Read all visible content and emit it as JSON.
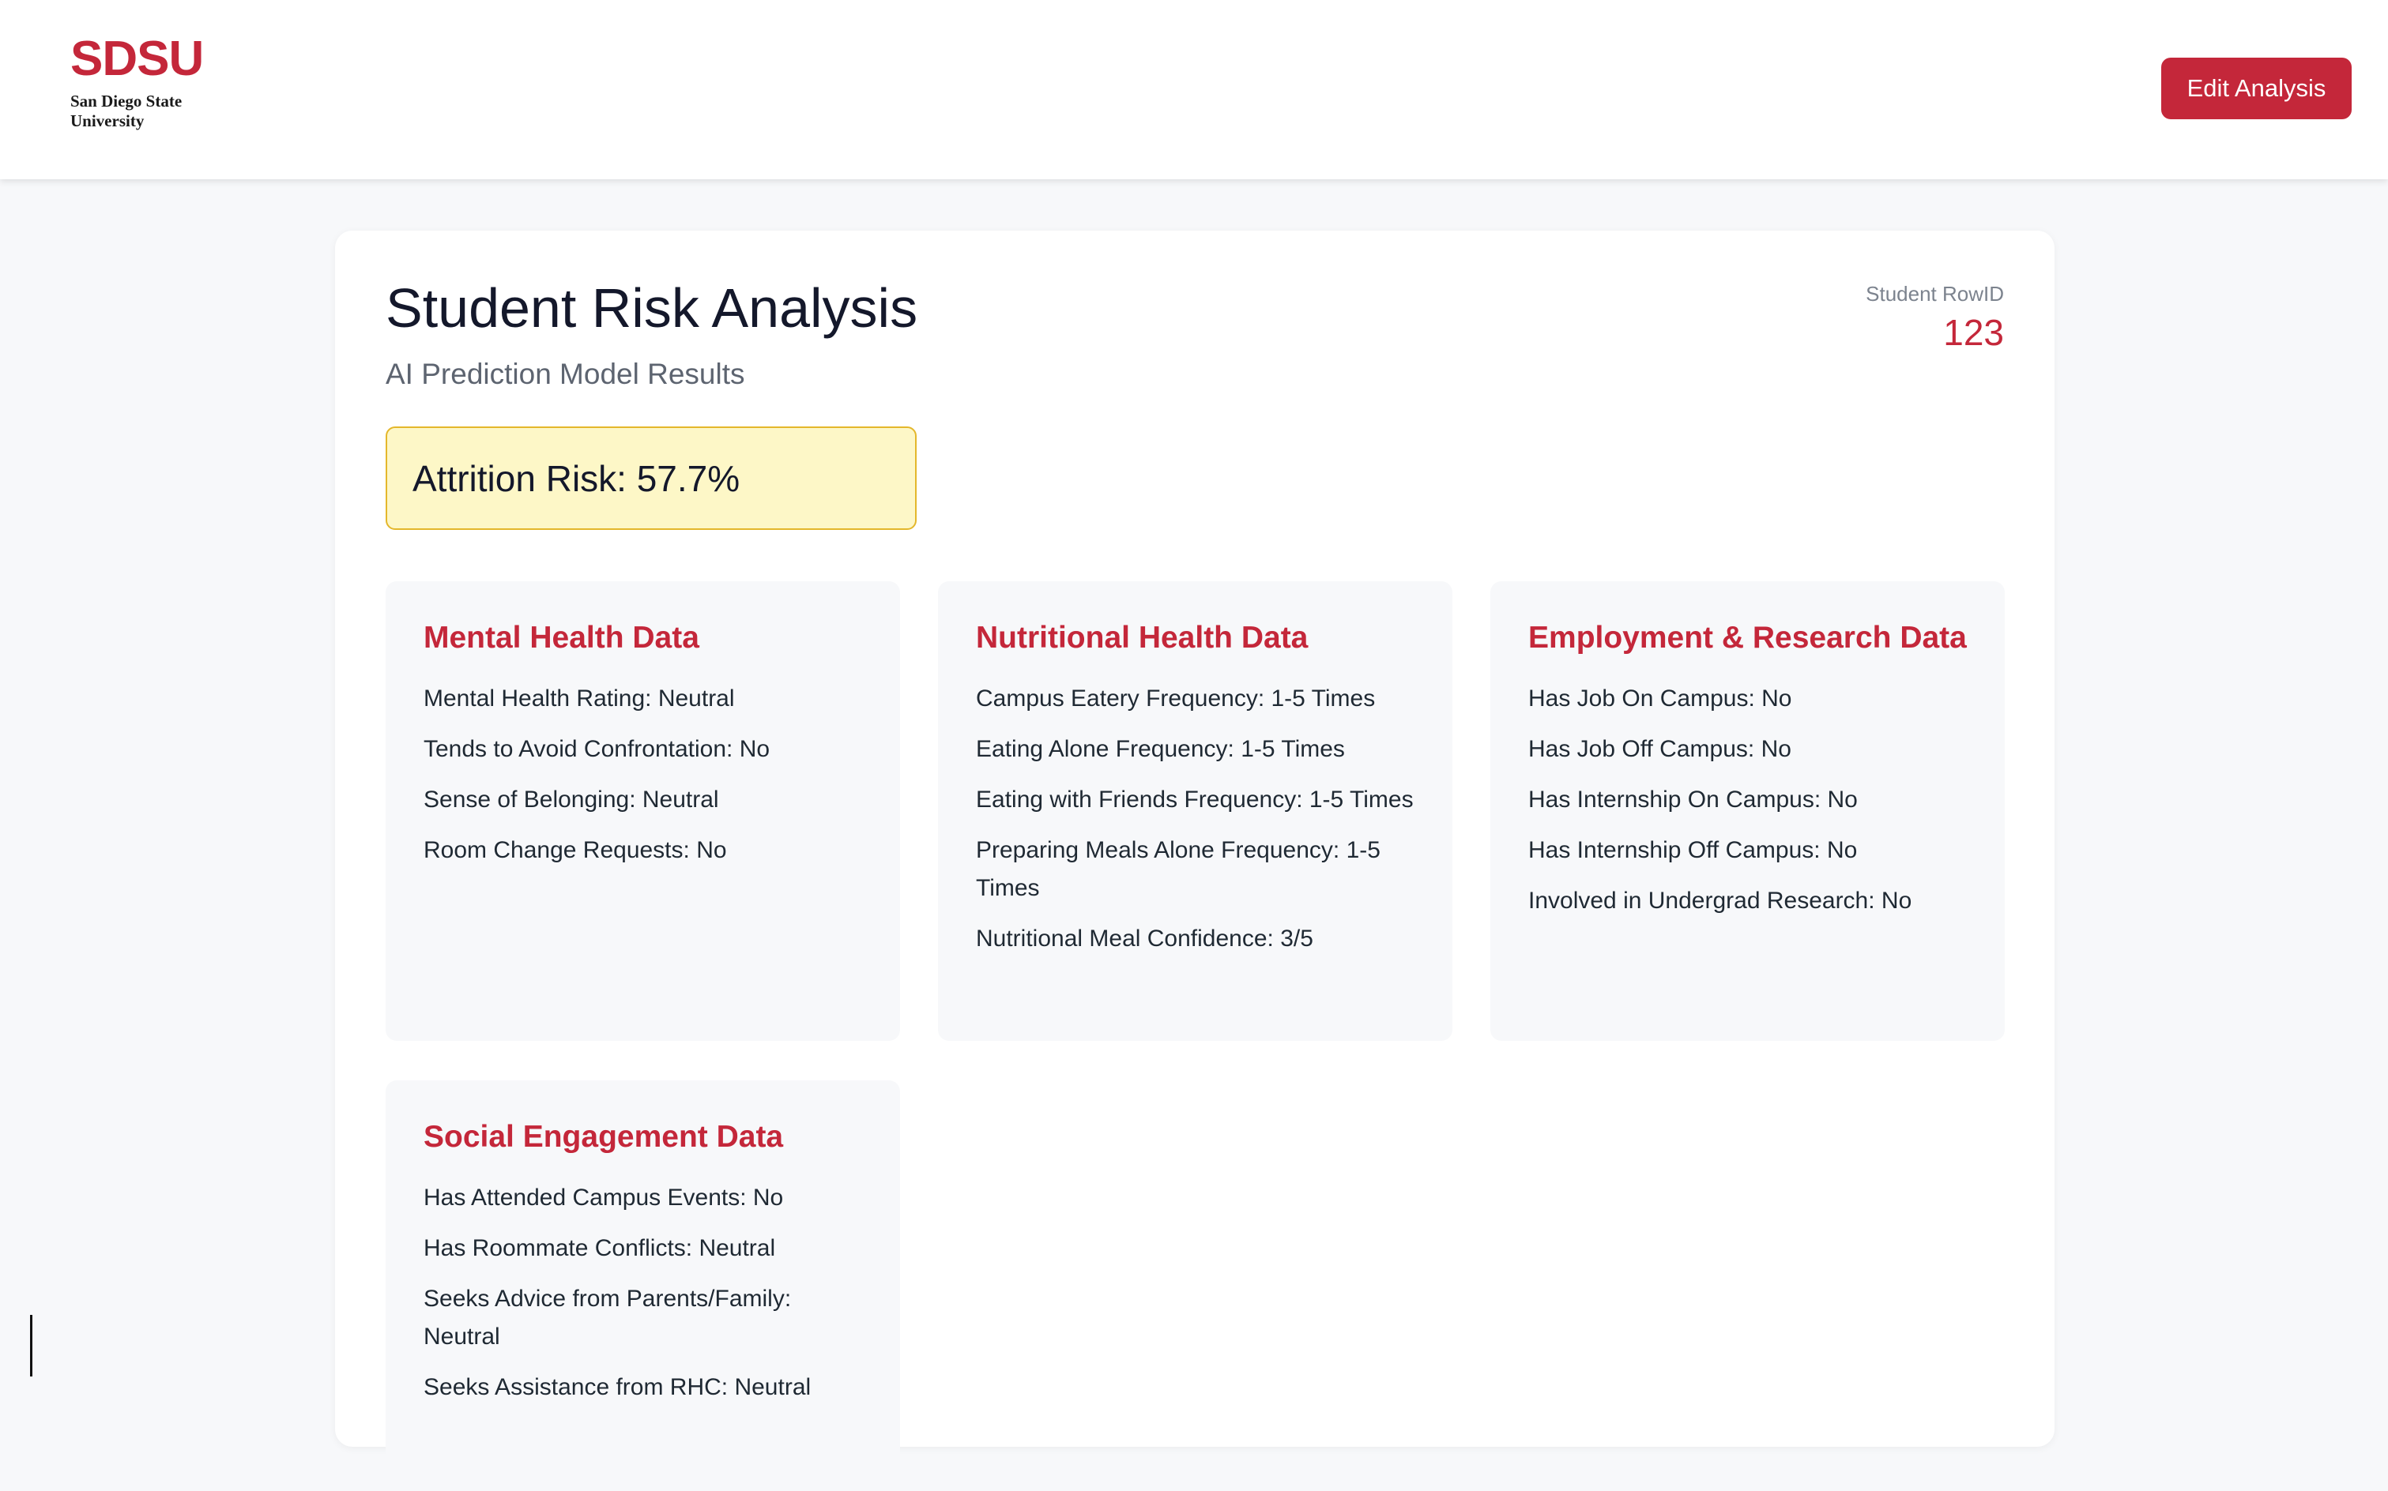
{
  "header": {
    "logo_mark": "SDSU",
    "logo_subtitle": "San Diego State\nUniversity",
    "edit_button_label": "Edit Analysis"
  },
  "page": {
    "title": "Student Risk Analysis",
    "subtitle": "AI Prediction Model Results",
    "rowid_label": "Student RowID",
    "rowid_value": "123",
    "attrition_risk": "Attrition Risk: 57.7%"
  },
  "panels": [
    {
      "title": "Mental Health Data",
      "items": [
        "Mental Health Rating: Neutral",
        "Tends to Avoid Confrontation: No",
        "Sense of Belonging: Neutral",
        "Room Change Requests: No"
      ]
    },
    {
      "title": "Nutritional Health Data",
      "items": [
        "Campus Eatery Frequency: 1-5 Times",
        "Eating Alone Frequency: 1-5 Times",
        "Eating with Friends Frequency: 1-5 Times",
        "Preparing Meals Alone Frequency: 1-5 Times",
        "Nutritional Meal Confidence: 3/5"
      ]
    },
    {
      "title": "Employment & Research Data",
      "items": [
        "Has Job On Campus: No",
        "Has Job Off Campus: No",
        "Has Internship On Campus: No",
        "Has Internship Off Campus: No",
        "Involved in Undergrad Research: No"
      ]
    },
    {
      "title": "Social Engagement Data",
      "items": [
        "Has Attended Campus Events: No",
        "Has Roommate Conflicts: Neutral",
        "Seeks Advice from Parents/Family: Neutral",
        "Seeks Assistance from RHC: Neutral"
      ]
    }
  ],
  "colors": {
    "brand_red": "#c4273a",
    "risk_background": "#fdf7c7",
    "risk_border": "#e4b72b"
  }
}
